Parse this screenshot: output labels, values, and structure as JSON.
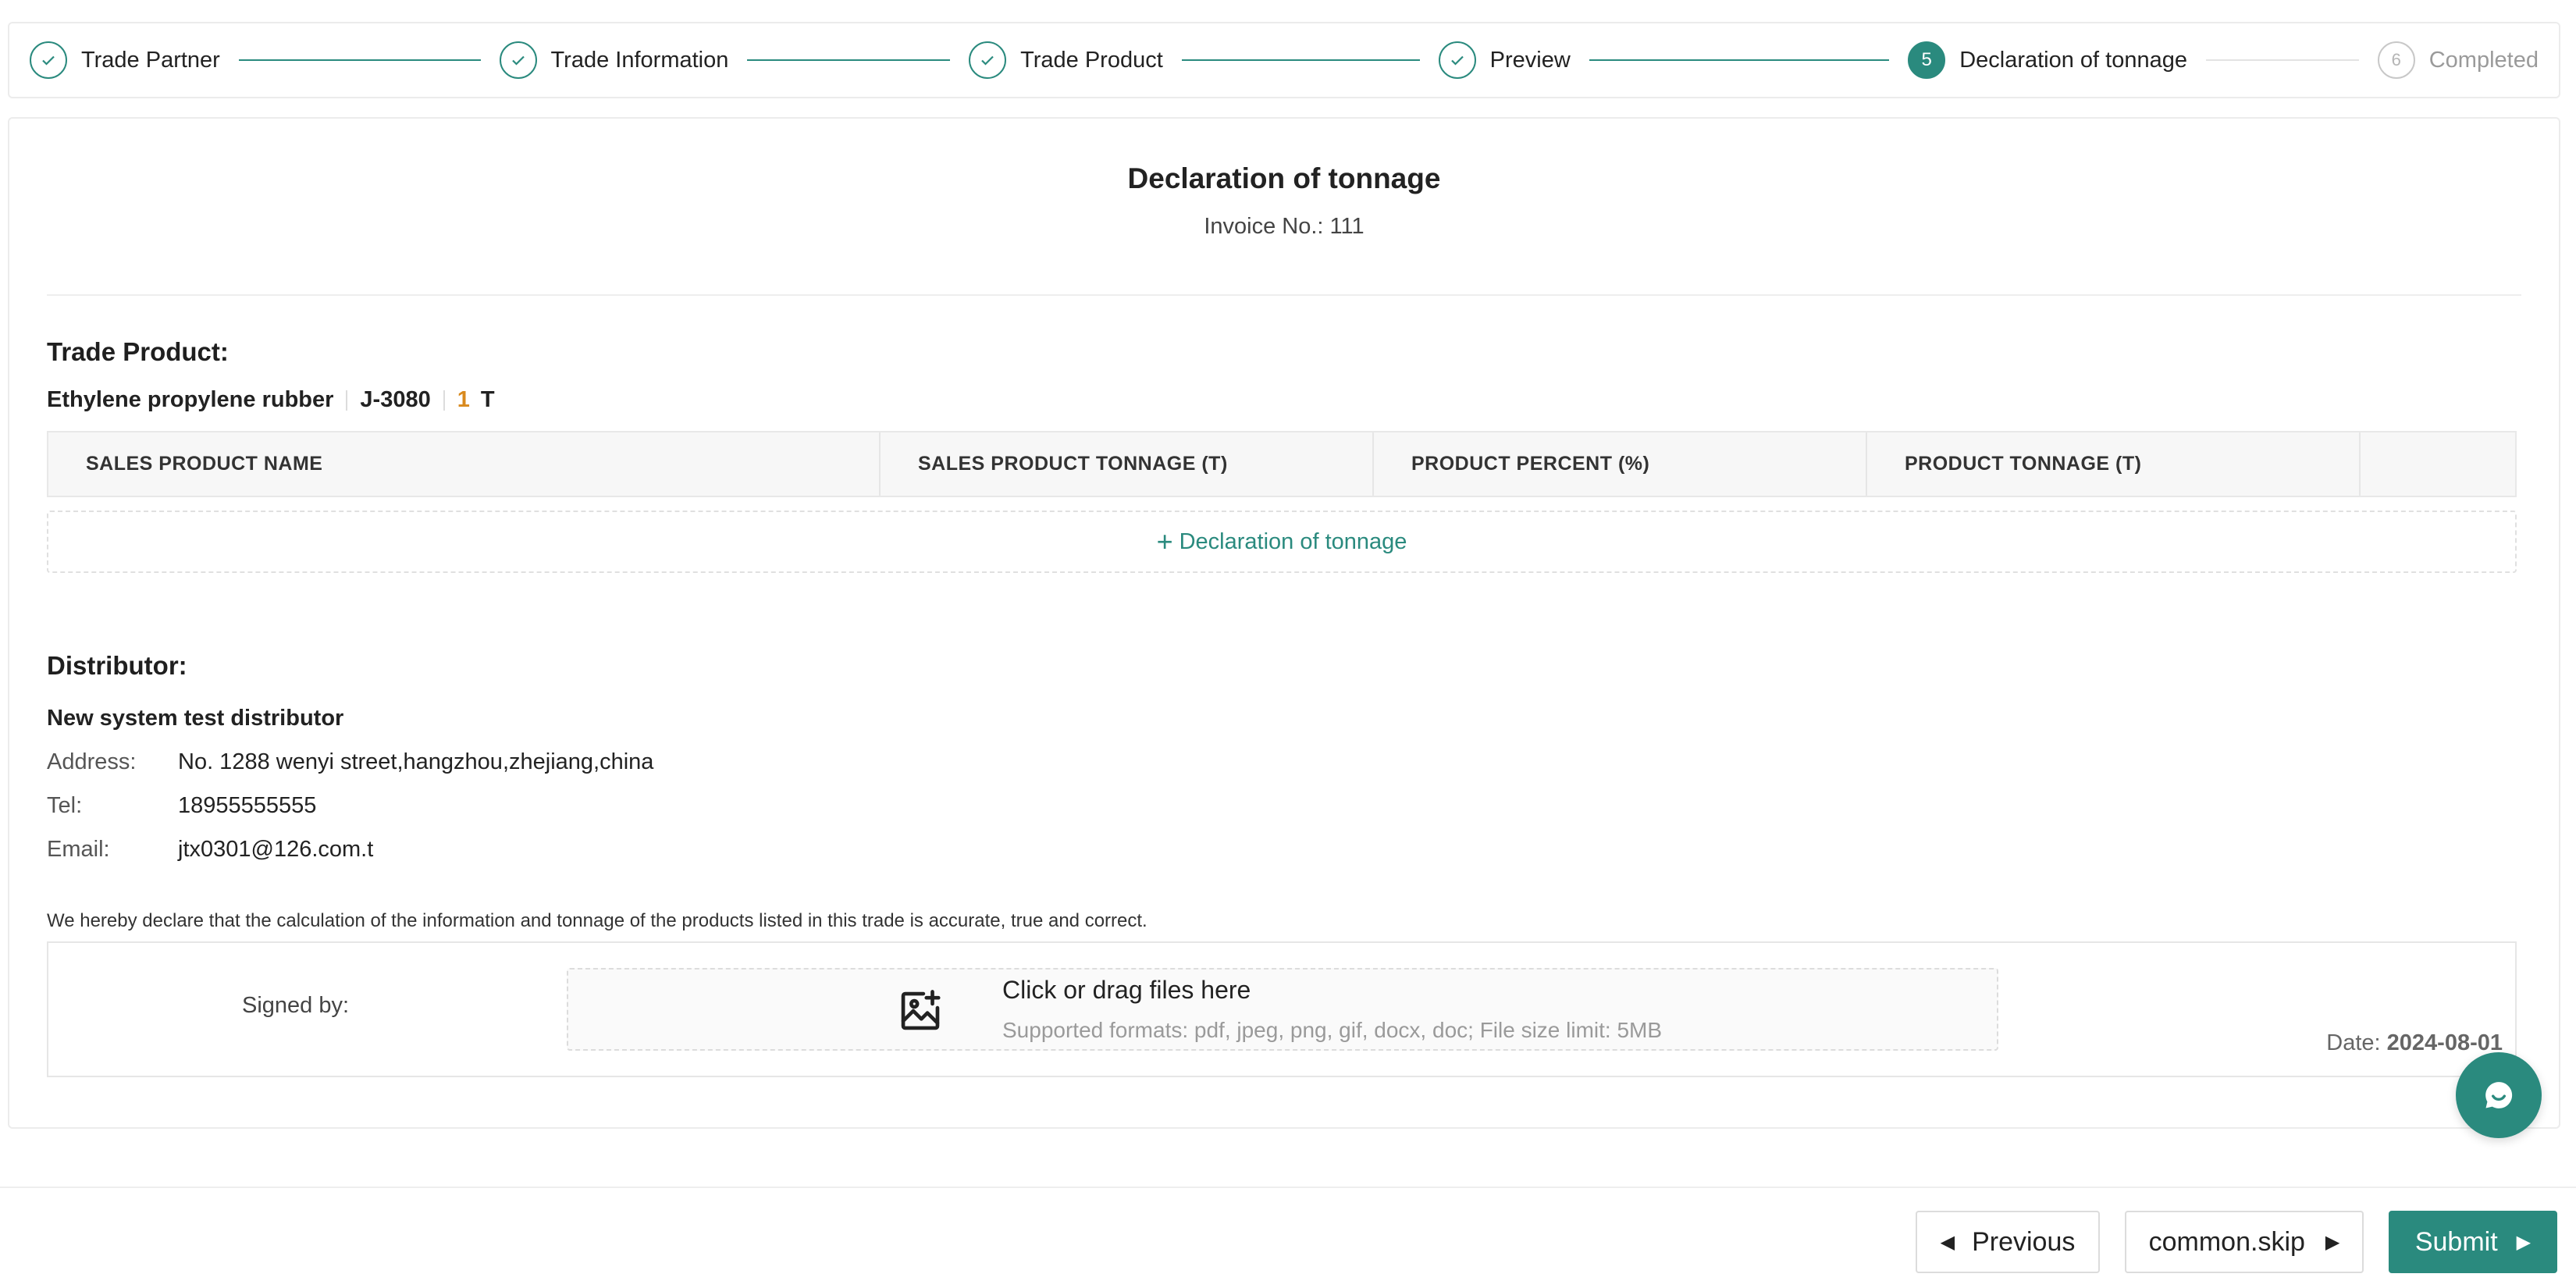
{
  "steps": [
    {
      "label": "Trade Partner",
      "status": "done"
    },
    {
      "label": "Trade Information",
      "status": "done"
    },
    {
      "label": "Trade Product",
      "status": "done"
    },
    {
      "label": "Preview",
      "status": "done"
    },
    {
      "label": "Declaration of tonnage",
      "status": "active",
      "number": "5"
    },
    {
      "label": "Completed",
      "status": "pending",
      "number": "6"
    }
  ],
  "document": {
    "title": "Declaration of tonnage",
    "invoice": "Invoice No.: 111"
  },
  "trade_product": {
    "section_title": "Trade Product:",
    "name": "Ethylene propylene rubber",
    "code": "J-3080",
    "quantity": "1",
    "unit": "T",
    "columns": [
      "SALES PRODUCT NAME",
      "SALES PRODUCT TONNAGE (T)",
      "PRODUCT PERCENT (%)",
      "PRODUCT TONNAGE (T)"
    ],
    "add_label": "Declaration of tonnage"
  },
  "distributor": {
    "section_title": "Distributor:",
    "name": "New system test distributor",
    "address_label": "Address:",
    "address": "No. 1288 wenyi street,hangzhou,zhejiang,china",
    "tel_label": "Tel:",
    "tel": "18955555555",
    "email_label": "Email:",
    "email": "jtx0301@126.com.t"
  },
  "declaration": {
    "statement": "We hereby declare that the calculation of the information and tonnage of the products listed in this trade is accurate, true and correct.",
    "signed_label": "Signed by:",
    "upload_title": "Click or drag files here",
    "upload_hint": "Supported formats: pdf, jpeg, png, gif, docx, doc; File size limit: 5MB",
    "date_label": "Date:",
    "date_value": "2024-08-01"
  },
  "footer": {
    "previous_label": "Previous",
    "skip_label": "common.skip",
    "submit_label": "Submit"
  },
  "colors": {
    "primary": "#2a8a7e",
    "quantity": "#d98a1e"
  },
  "icons": [
    "check-icon",
    "image-upload-icon",
    "chat-icon",
    "plus-icon",
    "caret-left-icon",
    "caret-right-icon"
  ]
}
